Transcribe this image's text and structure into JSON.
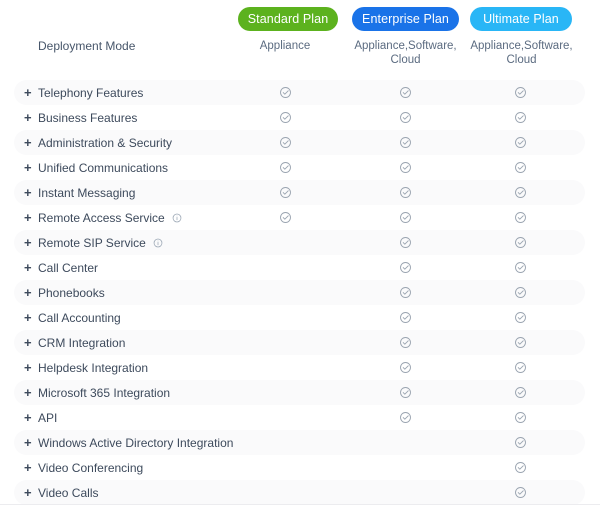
{
  "plans": [
    {
      "label": "Standard Plan",
      "color": "#5cb21e",
      "key": "standard"
    },
    {
      "label": "Enterprise Plan",
      "color": "#1a73e8",
      "key": "enterprise"
    },
    {
      "label": "Ultimate Plan",
      "color": "#29b6f6",
      "key": "ultimate"
    }
  ],
  "header": {
    "row_label": "Deployment Mode",
    "columns": [
      "Appliance",
      "Appliance,Software, Cloud",
      "Appliance,Software, Cloud"
    ]
  },
  "icons": {
    "expand": "+",
    "info": "info-circle-icon",
    "check": "check-circle-icon"
  },
  "features": [
    {
      "label": "Telephony Features",
      "info": false,
      "checks": [
        true,
        true,
        true
      ]
    },
    {
      "label": "Business Features",
      "info": false,
      "checks": [
        true,
        true,
        true
      ]
    },
    {
      "label": "Administration & Security",
      "info": false,
      "checks": [
        true,
        true,
        true
      ]
    },
    {
      "label": "Unified Communications",
      "info": false,
      "checks": [
        true,
        true,
        true
      ]
    },
    {
      "label": "Instant Messaging",
      "info": false,
      "checks": [
        true,
        true,
        true
      ]
    },
    {
      "label": "Remote Access Service",
      "info": true,
      "checks": [
        true,
        true,
        true
      ]
    },
    {
      "label": "Remote SIP Service",
      "info": true,
      "checks": [
        false,
        true,
        true
      ]
    },
    {
      "label": "Call Center",
      "info": false,
      "checks": [
        false,
        true,
        true
      ]
    },
    {
      "label": "Phonebooks",
      "info": false,
      "checks": [
        false,
        true,
        true
      ]
    },
    {
      "label": "Call Accounting",
      "info": false,
      "checks": [
        false,
        true,
        true
      ]
    },
    {
      "label": "CRM Integration",
      "info": false,
      "checks": [
        false,
        true,
        true
      ]
    },
    {
      "label": "Helpdesk Integration",
      "info": false,
      "checks": [
        false,
        true,
        true
      ]
    },
    {
      "label": "Microsoft 365 Integration",
      "info": false,
      "checks": [
        false,
        true,
        true
      ]
    },
    {
      "label": "API",
      "info": false,
      "checks": [
        false,
        true,
        true
      ]
    },
    {
      "label": "Windows Active Directory Integration",
      "info": false,
      "checks": [
        false,
        false,
        true
      ]
    },
    {
      "label": "Video Conferencing",
      "info": false,
      "checks": [
        false,
        false,
        true
      ]
    },
    {
      "label": "Video Calls",
      "info": false,
      "checks": [
        false,
        false,
        true
      ]
    }
  ]
}
